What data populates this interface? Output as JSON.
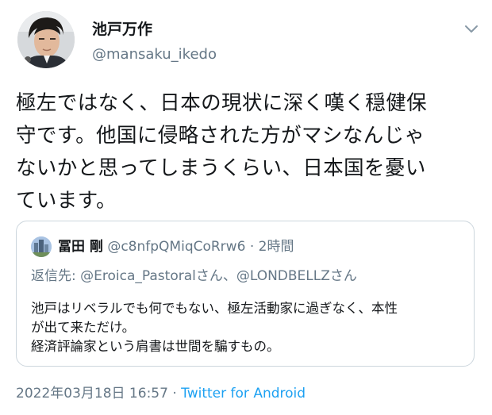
{
  "author": {
    "name": "池戸万作",
    "handle": "@mansaku_ikedo"
  },
  "tweet": {
    "lines": [
      "極左ではなく、日本の現状に深く嘆く穏健保",
      "守です。他国に侵略された方がマシなんじゃ",
      "ないかと思ってしまうくらい、日本国を憂い",
      "ています。"
    ]
  },
  "quoted": {
    "name": "冨田 剛",
    "handle": "@c8nfpQMiqCoRrw6",
    "separator": "·",
    "time": "2時間",
    "reply_prefix": "返信先: ",
    "reply_to": "@Eroica_Pastoralさん、@LONDBELLZさん",
    "lines": [
      "池戸はリベラルでも何でもない、極左活動家に過ぎなく、本性",
      "が出て来ただけ。",
      "経済評論家という肩書は世間を騙すもの。"
    ]
  },
  "meta": {
    "timestamp": "2022年03月18日 16:57",
    "separator": "·",
    "source": "Twitter for Android"
  },
  "icons": {
    "menu": "chevron-down-icon"
  },
  "colors": {
    "text": "#14171a",
    "secondary": "#657786",
    "link": "#1da1f2",
    "border": "#ccd6dd"
  }
}
